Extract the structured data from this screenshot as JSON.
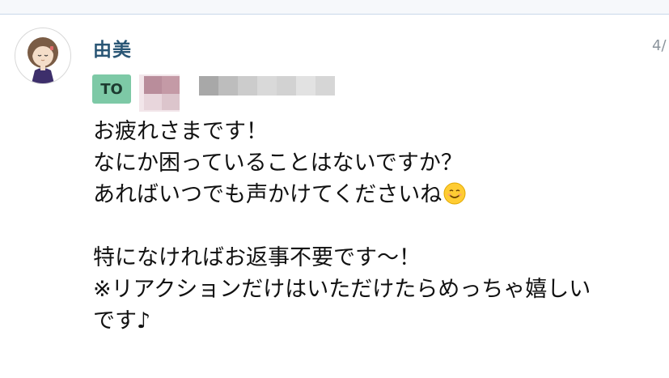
{
  "message": {
    "author": "由美",
    "timestamp": "4/",
    "to_badge": "TO",
    "to_recipient_icon": "blurred-avatar-icon",
    "body_lines": [
      "お疲れさまです！",
      "なにか困っていることはないですか？",
      "あればいつでも声かけてくださいね",
      "",
      "特になければお返事不要です〜！",
      "※リアクションだけはいただけたらめっちゃ嬉しい",
      "です♪"
    ],
    "emoji": "smiling-face-icon"
  },
  "colors": {
    "author": "#2a5675",
    "to_badge_bg": "#7dc9a6",
    "topbar_border": "#c9d8ea"
  }
}
